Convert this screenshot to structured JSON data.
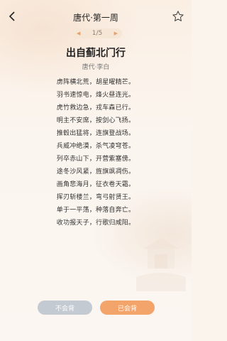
{
  "header": {
    "title": "唐代·第一周",
    "back_icon": "chevron-left-icon",
    "favorite_icon": "star-outline-icon"
  },
  "pager": {
    "label": "1/5",
    "prev_icon": "triangle-left-icon",
    "next_icon": "triangle-right-icon"
  },
  "poem": {
    "title": "出自蓟北门行",
    "author": "唐代·李白",
    "lines": [
      "虏阵横北荒，胡星曜精芒。",
      "羽书速惊电，烽火昼连光。",
      "虎竹救边急，戎车森已行。",
      "明主不安席，按剑心飞扬。",
      "推毂出猛将，连旗登战场。",
      "兵威冲绝漠，杀气凌穹苍。",
      "列卒赤山下，开营紫塞傍。",
      "途冬沙风紧，旌旗飒凋伤。",
      "画角悲海月，征衣卷天霜。",
      "挥刃斩楼兰，弯弓射贤王。",
      "单于一平荡，种落自奔亡。",
      "收功报天子，行歌归咸阳。"
    ]
  },
  "actions": {
    "not_memorized": "不会背",
    "memorized": "已会背"
  },
  "colors": {
    "accent": "#f3a46b",
    "disabled": "#c4cad1"
  }
}
